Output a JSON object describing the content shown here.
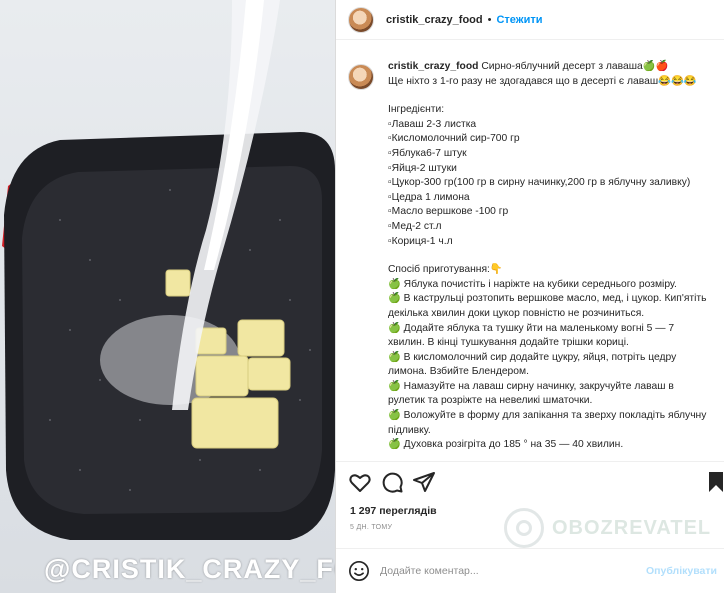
{
  "media": {
    "watermark": "@CRISTIK_CRAZY_FOOD"
  },
  "header": {
    "username": "cristik_crazy_food",
    "separator": "•",
    "follow_label": "Стежити"
  },
  "caption": {
    "username": "cristik_crazy_food",
    "title": "Сирно-яблучний десерт з лаваша🍏🍎",
    "lines": [
      "Ще ніхто з 1-го разу не здогадався що в десерті є лаваш😂😂😂",
      "",
      "Інгредієнти:",
      "▫Лаваш 2-3 листка",
      "▫Кисломолочний сир-700 гр",
      "▫Яблука6-7 штук",
      "▫Яйця-2 штуки",
      "▫Цукор-300 гр(100 гр в сирну начинку,200 гр в яблучну заливку)",
      "▫Цедра 1 лимона",
      "▫Масло вершкове -100 гр",
      "▫Мед-2 ст.л",
      "▫Кориця-1 ч.л",
      "",
      "Спосіб приготування:👇",
      "🍏 Яблука почистіть і наріжте на кубики середнього розміру.",
      "🍏 В каструльці розтопить вершкове масло, мед, і цукор. Кип'ятіть",
      "декілька хвилин доки цукор повністю не розчиниться.",
      "🍏 Додайте яблука та тушку йти на маленькому вогні 5 — 7",
      "хвилин. В кінці тушкування додайте трішки кориці.",
      "🍏 В кисломолочний сир додайте цукру, яйця, потріть цедру",
      "лимона. Взбийте Блендером.",
      "🍏 Намазуйте на лаваш сирну начинку, закручуйте лаваш в",
      "рулетик та розріжте на невеликі шматочки.",
      "🍏 Воложуйте в форму для запікання та зверху покладіть яблучну",
      "підливку.",
      "🍏 Духовка розігріта до 185 ° на 35 — 40 хвилин."
    ]
  },
  "stats": {
    "views": "1 297 переглядів",
    "date": "5 ДН. ТОМУ"
  },
  "brand": {
    "text": "OBOZREVATEL"
  },
  "comment": {
    "placeholder": "Додайте коментар...",
    "publish_label": "Опублікувати"
  },
  "icons": {
    "like": "heart-icon",
    "comment": "comment-icon",
    "share": "share-icon",
    "save": "bookmark-icon",
    "emoji": "emoji-icon"
  }
}
